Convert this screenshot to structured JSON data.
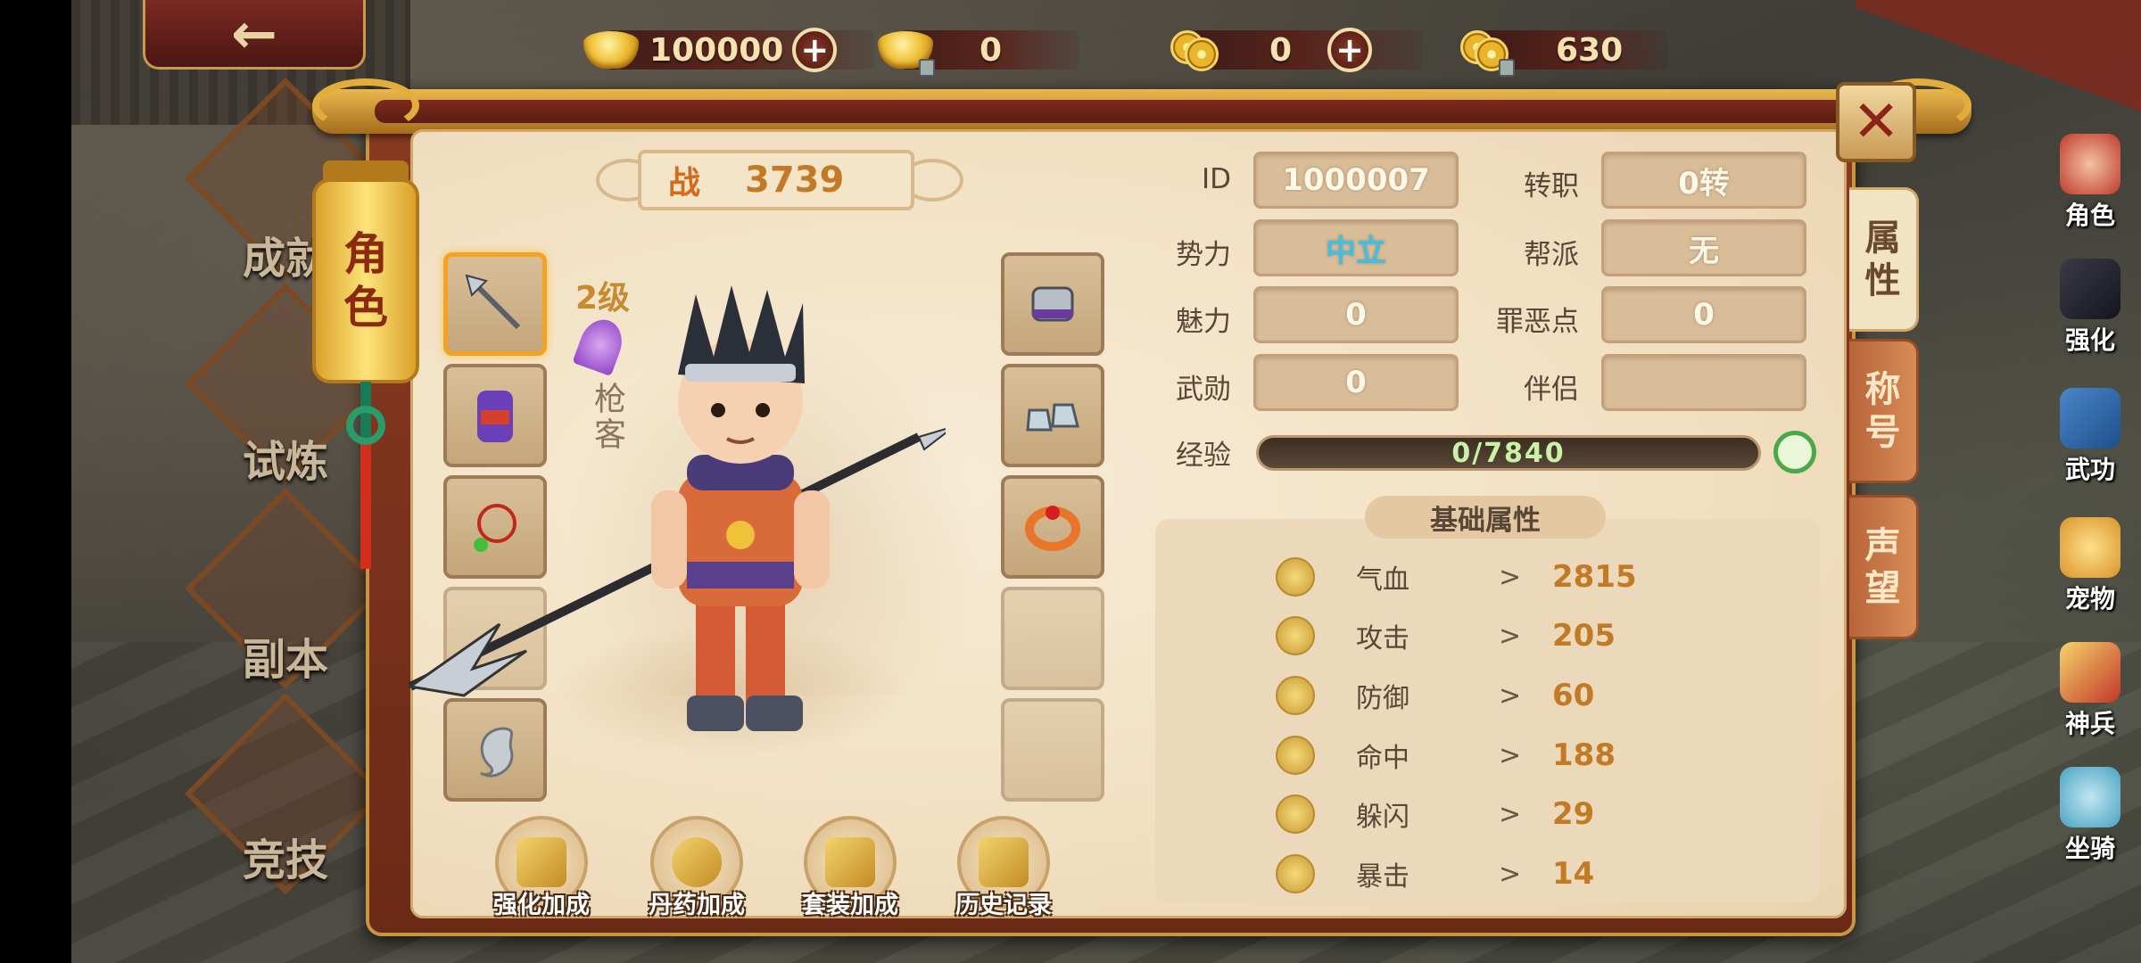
{
  "currency": [
    {
      "name": "gold-ingot",
      "value": "100000",
      "has_plus": true,
      "locked": false,
      "icon": "ingot"
    },
    {
      "name": "bound-ingot",
      "value": "0",
      "has_plus": false,
      "locked": true,
      "icon": "ingot"
    },
    {
      "name": "coins",
      "value": "0",
      "has_plus": true,
      "locked": false,
      "icon": "coins"
    },
    {
      "name": "bound-coins",
      "value": "630",
      "has_plus": false,
      "locked": true,
      "icon": "coins"
    }
  ],
  "plus_symbol": "+",
  "back_symbol": "←",
  "close_symbol": "✕",
  "left_menu": [
    "成就",
    "试炼",
    "副本",
    "竞技"
  ],
  "right_menu": [
    "角色",
    "强化",
    "武功",
    "宠物",
    "神兵",
    "坐骑"
  ],
  "lantern_tab": [
    "角",
    "色"
  ],
  "power": {
    "label": "战",
    "value": "3739"
  },
  "character": {
    "level": "2级",
    "class": "枪客"
  },
  "info": {
    "id_label": "ID",
    "id_value": "1000007",
    "job_label": "转职",
    "job_value": "0转",
    "faction_label": "势力",
    "faction_value": "中立",
    "guild_label": "帮派",
    "guild_value": "无",
    "charm_label": "魅力",
    "charm_value": "0",
    "evil_label": "罪恶点",
    "evil_value": "0",
    "merit_label": "武勋",
    "merit_value": "0",
    "partner_label": "伴侣",
    "partner_value": ""
  },
  "experience": {
    "label": "经验",
    "value": "0/7840",
    "progress": 0
  },
  "base_attributes": {
    "title": "基础属性",
    "items": [
      {
        "name": "气血",
        "value": "2815"
      },
      {
        "name": "攻击",
        "value": "205"
      },
      {
        "name": "防御",
        "value": "60"
      },
      {
        "name": "命中",
        "value": "188"
      },
      {
        "name": "躲闪",
        "value": "29"
      },
      {
        "name": "暴击",
        "value": "14"
      }
    ],
    "arrow": ">"
  },
  "side_tabs": [
    {
      "label": [
        "属",
        "性"
      ],
      "active": true
    },
    {
      "label": [
        "称",
        "号"
      ],
      "active": false
    },
    {
      "label": [
        "声",
        "望"
      ],
      "active": false
    }
  ],
  "actions": [
    "强化加成",
    "丹药加成",
    "套装加成",
    "历史记录"
  ],
  "colors": {
    "accent": "#c27a24",
    "faction": "#3cc0e8",
    "exp_text": "#c9f2a6"
  }
}
